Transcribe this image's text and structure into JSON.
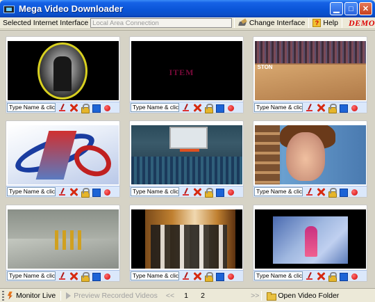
{
  "window": {
    "title": "Mega Video Downloader",
    "icon": "film-icon",
    "controls": [
      "minimize",
      "maximize",
      "close"
    ]
  },
  "toolbar": {
    "interface_label": "Selected Internet Interface",
    "interface_value": "Local Area Connection",
    "change_interface_label": "Change Interface",
    "help_label": "Help",
    "demo_label": "DEMO"
  },
  "videos": [
    {
      "name_placeholder": "Type Name & click Pre"
    },
    {
      "name_placeholder": "Type Name & click Pre"
    },
    {
      "name_placeholder": "Type Name & click Pre"
    },
    {
      "name_placeholder": "Type Name & click Pre"
    },
    {
      "name_placeholder": "Type Name & click Pre"
    },
    {
      "name_placeholder": "Type Name & click Pre"
    },
    {
      "name_placeholder": "Type Name & click Pre"
    },
    {
      "name_placeholder": "Type Name & click Pre"
    },
    {
      "name_placeholder": "Type Name & click Pre"
    }
  ],
  "video_overlay_texts": {
    "v2_logo": "ITEM",
    "v3_tag": "STON"
  },
  "cell_controls": [
    "brush-icon",
    "delete-icon",
    "lock-icon",
    "stop-icon",
    "record-icon"
  ],
  "statusbar": {
    "monitor_live_label": "Monitor Live",
    "preview_label": "Preview Recorded Videos",
    "prev_label": "<<",
    "page_current": "1",
    "page_other": "2",
    "next_label": ">>",
    "open_folder_label": "Open Video Folder"
  },
  "colors": {
    "titlebar": "#0a55d8",
    "demo": "#dd0000",
    "control_strip": "#dbe8fb",
    "workspace": "#d6d3c6"
  }
}
